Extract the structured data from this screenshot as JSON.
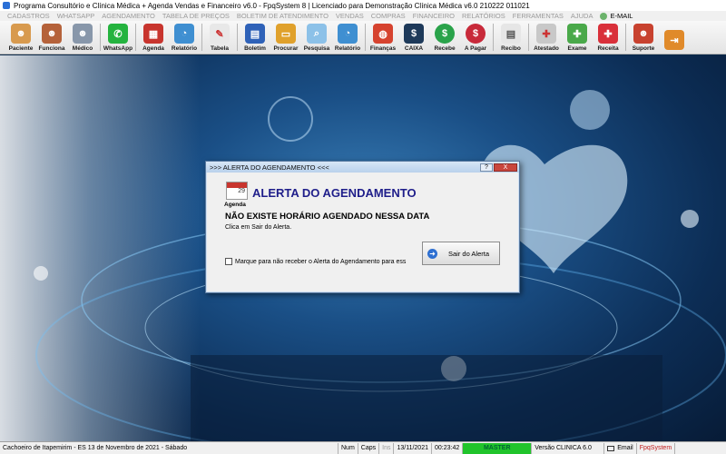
{
  "window": {
    "title": "Programa Consultório e Clínica Médica + Agenda Vendas e Financeiro v6.0 - FpqSystem 8 | Licenciado para  Demonstração Clínica Médica v6.0 210222 011021"
  },
  "menu": {
    "items": [
      "CADASTROS",
      "WHATSAPP",
      "AGENDAMENTO",
      "TABELA DE PREÇOS",
      "BOLETIM DE ATENDIMENTO",
      "VENDAS",
      "COMPRAS",
      "FINANCEIRO",
      "RELATÓRIOS",
      "FERRAMENTAS",
      "AJUDA"
    ],
    "email": "E-MAIL"
  },
  "toolbar": {
    "paciente": "Paciente",
    "funciona": "Funciona",
    "medico": "Médico",
    "whatsapp": "WhatsApp",
    "agenda": "Agenda",
    "relatorio": "Relatório",
    "tabela": "Tabela",
    "boletim": "Boletim",
    "procurar": "Procurar",
    "pesquisa": "Pesquisa",
    "relatorio2": "Relatório",
    "financas": "Finanças",
    "caixa": "CAIXA",
    "recebe": "Recebe",
    "apagar": "A Pagar",
    "recibo": "Recibo",
    "atestado": "Atestado",
    "exame": "Exame",
    "receita": "Receita",
    "suporte": "Suporte"
  },
  "dialog": {
    "title": ">>> ALERTA DO AGENDAMENTO <<<",
    "help": "?",
    "close": "X",
    "icon_label": "Agenda",
    "icon_number": "29",
    "heading": "ALERTA DO AGENDAMENTO",
    "message": "NÃO EXISTE HORÁRIO AGENDADO NESSA DATA",
    "sub": "Clica em Sair do Alerta.",
    "checkbox_label": "Marque para não receber o Alerta do Agendamento para ess",
    "exit_button": "Sair do Alerta"
  },
  "statusbar": {
    "location": "Cachoeiro de Itapemirim - ES 13 de Novembro de 2021 - Sábado",
    "num": "Num",
    "caps": "Caps",
    "ins": "Ins",
    "date": "13/11/2021",
    "time": "00:23:42",
    "master": "MASTER",
    "version": "Versão CLINICA 6.0",
    "email": "Email",
    "brand": "FpqSystem"
  },
  "colors": {
    "dialog_heading": "#1f1e8a",
    "master_bg": "#21c42b"
  }
}
